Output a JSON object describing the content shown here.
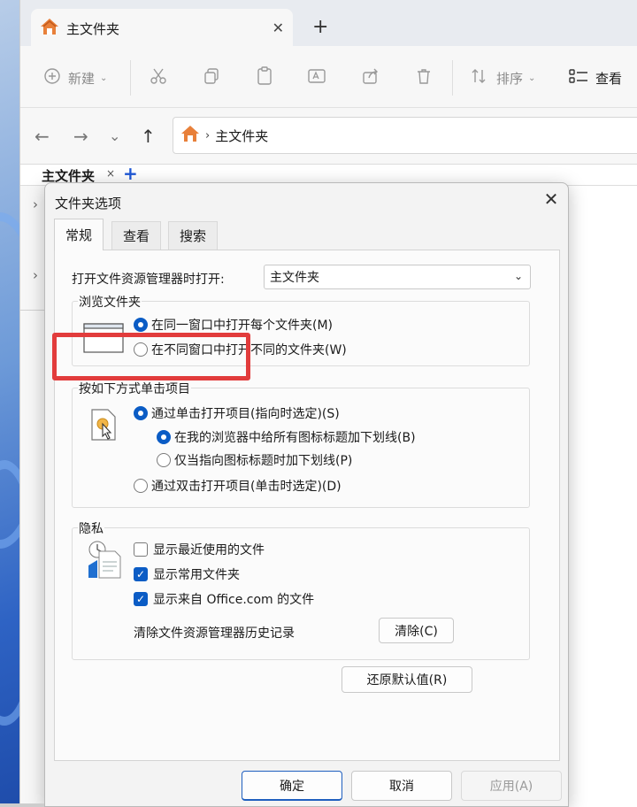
{
  "explorer": {
    "tab_title": "主文件夹",
    "new_tab": "+",
    "toolbar": {
      "new_label": "新建",
      "sort_label": "排序",
      "view_label": "查看"
    },
    "address_text": "主文件夹",
    "subtab_label": "主文件夹",
    "subtab_close": "×",
    "subtab_plus": "+"
  },
  "dialog": {
    "title": "文件夹选项",
    "tabs": [
      "常规",
      "查看",
      "搜索"
    ],
    "open_with_label": "打开文件资源管理器时打开:",
    "open_with_value": "主文件夹",
    "browse": {
      "title": "浏览文件夹",
      "same_window": "在同一窗口中打开每个文件夹(M)",
      "new_window": "在不同窗口中打开不同的文件夹(W)"
    },
    "click": {
      "title": "按如下方式单击项目",
      "single_click": "通过单击打开项目(指向时选定)(S)",
      "underline_all": "在我的浏览器中给所有图标标题加下划线(B)",
      "underline_point": "仅当指向图标标题时加下划线(P)",
      "double_click": "通过双击打开项目(单击时选定)(D)"
    },
    "privacy": {
      "title": "隐私",
      "show_recent": "显示最近使用的文件",
      "show_frequent": "显示常用文件夹",
      "show_office": "显示来自 Office.com 的文件",
      "clear_history_label": "清除文件资源管理器历史记录",
      "clear_button": "清除(C)"
    },
    "restore_defaults": "还原默认值(R)",
    "ok": "确定",
    "cancel": "取消",
    "apply": "应用(A)"
  },
  "colors": {
    "accent": "#0b5cc5",
    "highlight_box": "#e23c3c"
  }
}
